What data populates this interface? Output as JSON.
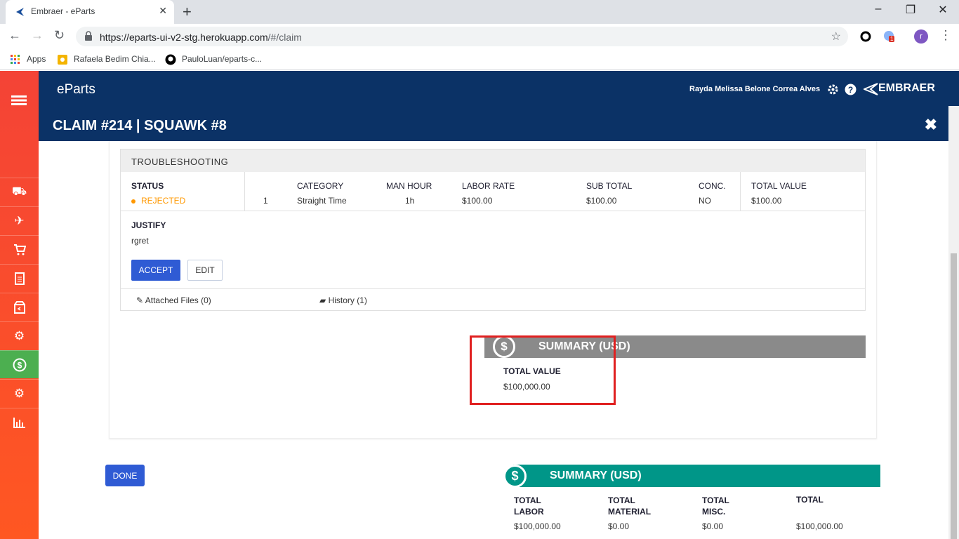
{
  "browser": {
    "tab_title": "Embraer - eParts",
    "url_host": "https://eparts-ui-v2-stg.herokuapp.com",
    "url_path": "/#/claim",
    "bookmarks": [
      "Apps",
      "Rafaela Bedim Chia...",
      "PauloLuan/eparts-c..."
    ],
    "profile_initial": "r",
    "ext_badge": "1"
  },
  "app": {
    "brand": "eParts",
    "user_name": "Rayda Melissa Belone Correa Alves",
    "logo_text": "EMBRAER",
    "sidebar_icons": [
      "truck-icon",
      "plane-icon",
      "cart-icon",
      "document-icon",
      "package-icon",
      "cog-hand-icon",
      "dollar-icon",
      "gears-icon",
      "chart-icon"
    ],
    "sidebar_active": "dollar-icon",
    "accent": "#0b3266",
    "sidebar_color": "#f44336"
  },
  "modal": {
    "title": "CLAIM #214 | SQUAWK #8",
    "troubleshooting": {
      "header": "TROUBLESHOOTING",
      "status_label": "STATUS",
      "status_value": "REJECTED",
      "status_color": "#ff9800",
      "columns": [
        "CATEGORY",
        "MAN HOUR",
        "LABOR RATE",
        "SUB TOTAL",
        "CONC.",
        "TOTAL VALUE"
      ],
      "row": {
        "index": "1",
        "category": "Straight Time",
        "man_hour": "1h",
        "labor_rate": "$100.00",
        "sub_total": "$100.00",
        "conc": "NO",
        "total_value": "$100.00"
      },
      "justify_label": "JUSTIFY",
      "justify_value": "rgret",
      "accept_label": "ACCEPT",
      "edit_label": "EDIT",
      "attached_files": "Attached Files (0)",
      "history": "History (1)"
    },
    "summary": {
      "title": "SUMMARY (USD)",
      "total_value_label": "TOTAL VALUE",
      "total_value": "$100,000.00"
    },
    "done_label": "DONE",
    "footer_summary": {
      "title": "SUMMARY (USD)",
      "columns": [
        {
          "label": "TOTAL LABOR",
          "value": "$100,000.00"
        },
        {
          "label": "TOTAL MATERIAL",
          "value": "$0.00"
        },
        {
          "label": "TOTAL MISC.",
          "value": "$0.00"
        },
        {
          "label": "TOTAL",
          "value": "$100,000.00"
        }
      ]
    }
  }
}
